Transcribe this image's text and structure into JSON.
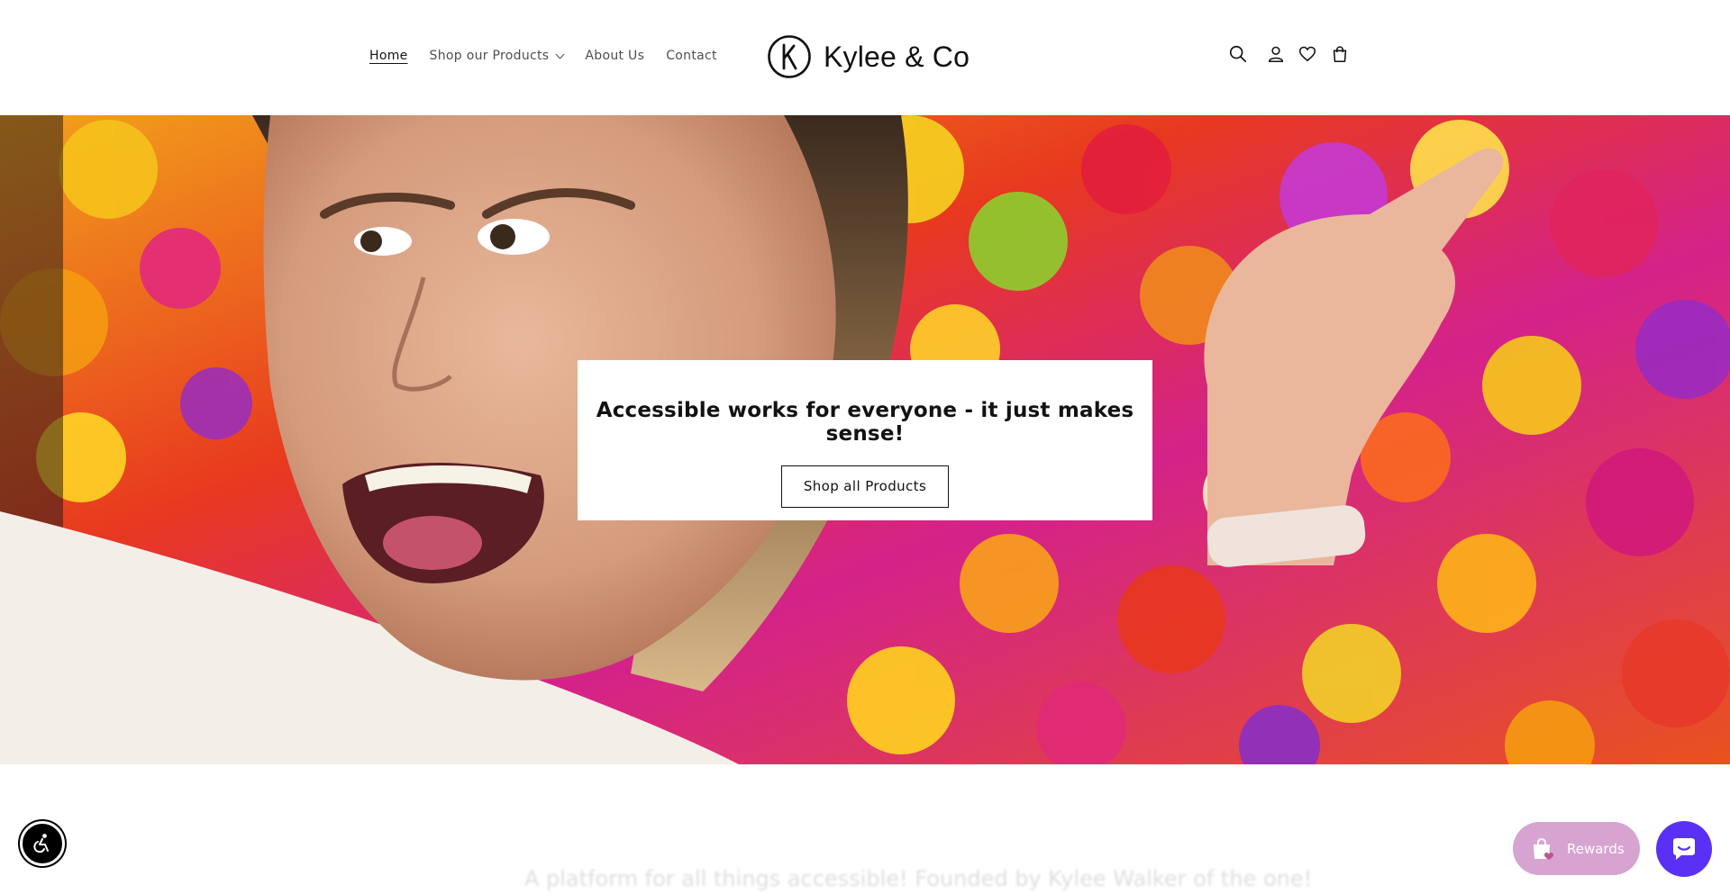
{
  "header": {
    "nav": {
      "home": "Home",
      "shop": "Shop our Products",
      "about": "About Us",
      "contact": "Contact"
    },
    "logo_text": "Kylee & Co",
    "icons": [
      "search-icon",
      "account-icon",
      "heart-icon",
      "cart-icon"
    ]
  },
  "hero": {
    "heading": "Accessible works for everyone - it just makes sense!",
    "button_label": "Shop all Products"
  },
  "next_section": {
    "heading": "A platform for all things accessible! Founded by Kylee Walker of the one!"
  },
  "widgets": {
    "rewards_label": "Rewards",
    "accessibility_icon": "accessibility-icon",
    "chat_icon": "chat-icon"
  },
  "colors": {
    "text": "#121212",
    "rewards": "#d7a4d1",
    "chat": "#5a31f4"
  }
}
